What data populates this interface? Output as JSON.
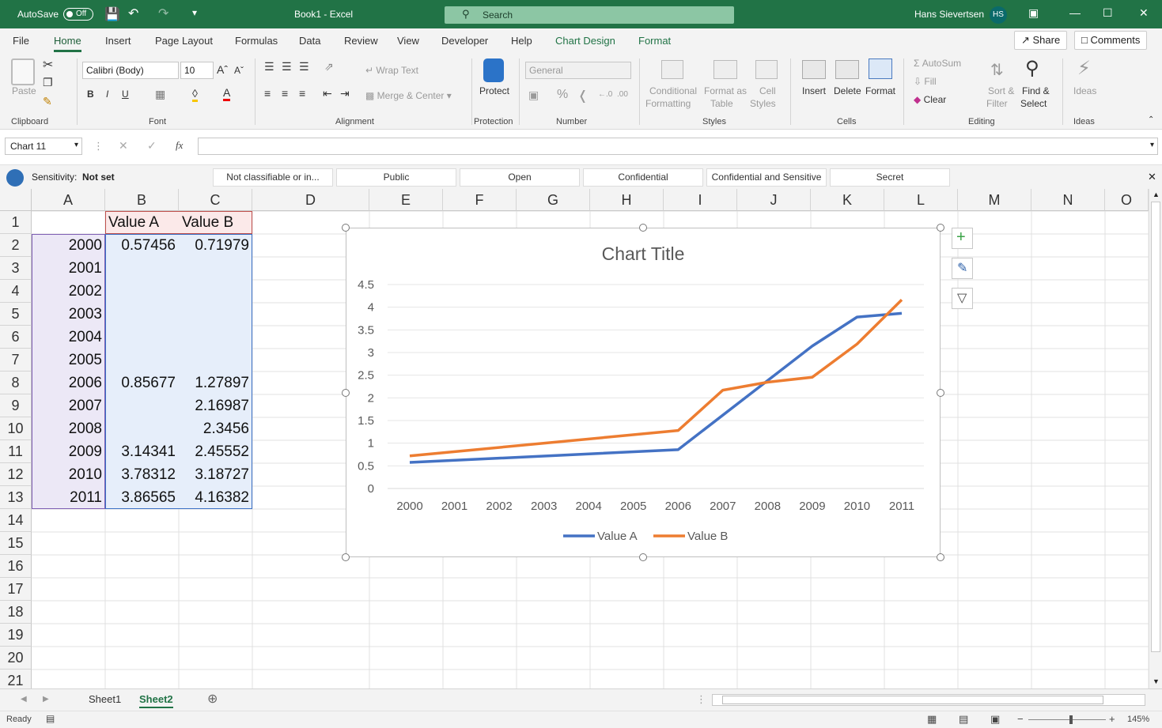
{
  "titlebar": {
    "autosave_label": "AutoSave",
    "autosave_state": "Off",
    "document_title": "Book1  -  Excel",
    "search_placeholder": "Search",
    "user_name": "Hans Sievertsen",
    "user_initials": "HS"
  },
  "tabs": [
    "File",
    "Home",
    "Insert",
    "Page Layout",
    "Formulas",
    "Data",
    "Review",
    "View",
    "Developer",
    "Help",
    "Chart Design",
    "Format"
  ],
  "active_tab": "Home",
  "share_label": "Share",
  "comments_label": "Comments",
  "ribbon": {
    "clipboard": {
      "label": "Clipboard",
      "paste": "Paste"
    },
    "font": {
      "label": "Font",
      "name": "Calibri (Body)",
      "size": "10"
    },
    "alignment": {
      "label": "Alignment",
      "wrap_text": "Wrap Text",
      "merge_center": "Merge & Center"
    },
    "protection": {
      "label": "Protection",
      "protect": "Protect"
    },
    "number": {
      "label": "Number",
      "format": "General"
    },
    "styles": {
      "label": "Styles",
      "conditional_1": "Conditional",
      "conditional_2": "Formatting",
      "format_as_1": "Format as",
      "format_as_2": "Table",
      "cell_styles_1": "Cell",
      "cell_styles_2": "Styles"
    },
    "cells": {
      "label": "Cells",
      "insert": "Insert",
      "delete": "Delete",
      "format": "Format"
    },
    "editing": {
      "label": "Editing",
      "autosum": "AutoSum",
      "fill": "Fill",
      "clear": "Clear",
      "sort_1": "Sort &",
      "sort_2": "Filter",
      "find_1": "Find &",
      "find_2": "Select"
    },
    "ideas": {
      "label": "Ideas",
      "ideas": "Ideas"
    }
  },
  "formula_bar": {
    "name_box": "Chart 11",
    "fx": "fx",
    "value": ""
  },
  "sensitivity": {
    "label": "Sensitivity:",
    "value": "Not set",
    "options": [
      "Not classifiable or in...",
      "Public",
      "Open",
      "Confidential",
      "Confidential and Sensitive",
      "Secret"
    ]
  },
  "columns": [
    "A",
    "B",
    "C",
    "D",
    "E",
    "F",
    "G",
    "H",
    "I",
    "J",
    "K",
    "L",
    "M",
    "N",
    "O"
  ],
  "rows": [
    "1",
    "2",
    "3",
    "4",
    "5",
    "6",
    "7",
    "8",
    "9",
    "10",
    "11",
    "12",
    "13",
    "14",
    "15",
    "16",
    "17",
    "18",
    "19",
    "20",
    "21"
  ],
  "table": {
    "headers": [
      "",
      "Value A",
      "Value B"
    ],
    "data": [
      [
        "2000",
        "0.57456",
        "0.71979"
      ],
      [
        "2001",
        "",
        ""
      ],
      [
        "2002",
        "",
        ""
      ],
      [
        "2003",
        "",
        ""
      ],
      [
        "2004",
        "",
        ""
      ],
      [
        "2005",
        "",
        ""
      ],
      [
        "2006",
        "0.85677",
        "1.27897"
      ],
      [
        "2007",
        "",
        "2.16987"
      ],
      [
        "2008",
        "",
        "2.3456"
      ],
      [
        "2009",
        "3.14341",
        "2.45552"
      ],
      [
        "2010",
        "3.78312",
        "3.18727"
      ],
      [
        "2011",
        "3.86565",
        "4.16382"
      ]
    ]
  },
  "chart_data": {
    "type": "line",
    "title": "Chart Title",
    "categories": [
      "2000",
      "2001",
      "2002",
      "2003",
      "2004",
      "2005",
      "2006",
      "2007",
      "2008",
      "2009",
      "2010",
      "2011"
    ],
    "series": [
      {
        "name": "Value A",
        "color": "#4472c4",
        "values": [
          0.57456,
          null,
          null,
          null,
          null,
          null,
          0.85677,
          null,
          null,
          3.14341,
          3.78312,
          3.86565
        ]
      },
      {
        "name": "Value B",
        "color": "#ed7d31",
        "values": [
          0.71979,
          null,
          null,
          null,
          null,
          null,
          1.27897,
          2.16987,
          2.3456,
          2.45552,
          3.18727,
          4.16382
        ]
      }
    ],
    "ylim": [
      0,
      4.5
    ],
    "yticks": [
      "0",
      "0.5",
      "1",
      "1.5",
      "2",
      "2.5",
      "3",
      "3.5",
      "4",
      "4.5"
    ],
    "grid": true,
    "legend": "bottom"
  },
  "sheet_tabs": [
    "Sheet1",
    "Sheet2"
  ],
  "active_sheet": "Sheet2",
  "status": {
    "ready": "Ready",
    "zoom": "145%"
  }
}
